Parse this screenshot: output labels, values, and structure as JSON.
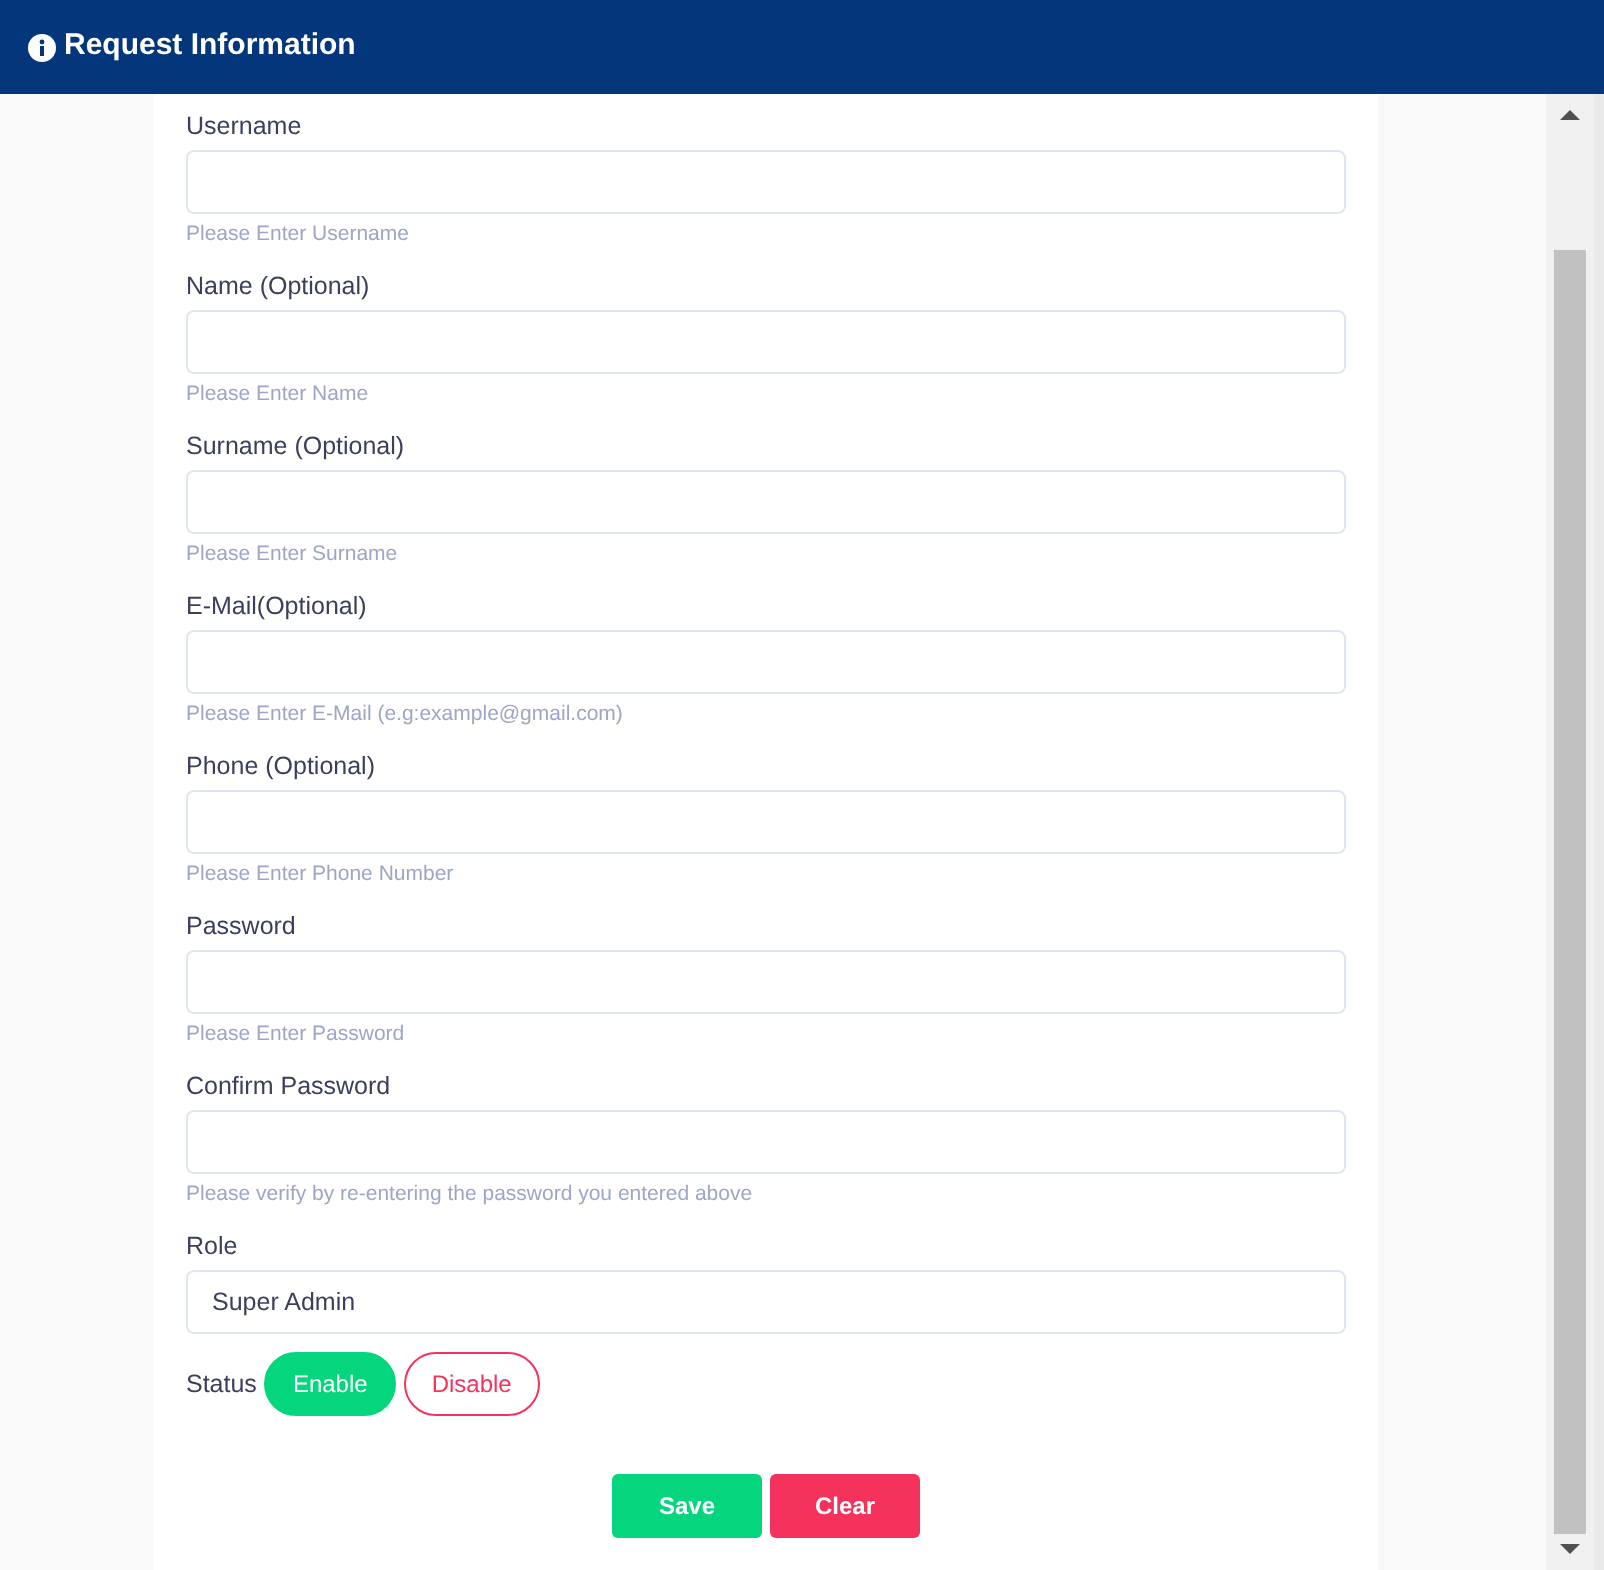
{
  "header": {
    "title": "Request Information"
  },
  "fields": [
    {
      "label": "Username",
      "kind": "text",
      "help": "Please Enter Username"
    },
    {
      "label": "Name (Optional)",
      "kind": "text",
      "help": "Please Enter Name"
    },
    {
      "label": "Surname (Optional)",
      "kind": "text",
      "help": "Please Enter Surname"
    },
    {
      "label": "E-Mail(Optional)",
      "kind": "text",
      "help": "Please Enter E-Mail (e.g:example@gmail.com)"
    },
    {
      "label": "Phone (Optional)",
      "kind": "text",
      "help": "Please Enter Phone Number"
    },
    {
      "label": "Password",
      "kind": "password",
      "help": "Please Enter Password"
    },
    {
      "label": "Confirm Password",
      "kind": "password",
      "help": "Please verify by re-entering the password you entered above"
    },
    {
      "label": "Role",
      "kind": "select",
      "value": "Super Admin"
    }
  ],
  "status": {
    "label": "Status",
    "options": [
      {
        "label": "Enable",
        "selected": true,
        "color": "#05d67e"
      },
      {
        "label": "Disable",
        "selected": false,
        "color": "#f5325c"
      }
    ]
  },
  "buttons": [
    {
      "label": "Save",
      "color": "#05d67e"
    },
    {
      "label": "Clear",
      "color": "#f5325c"
    }
  ]
}
